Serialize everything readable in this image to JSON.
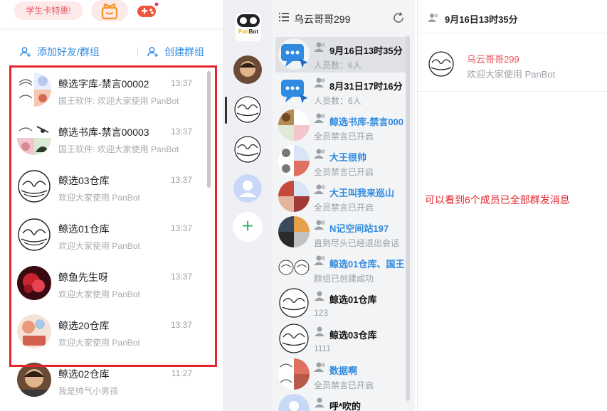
{
  "header": {
    "promo_label": "学生卡特惠!",
    "gift_icon": "gift-icon",
    "game_icon": "gamepad-icon"
  },
  "actions": {
    "add_friend_label": "添加好友/群组",
    "create_group_label": "创建群组"
  },
  "chats": [
    {
      "name": "鲸选字库-禁言00002",
      "time": "13:37",
      "message": "国王软件: 欢迎大家使用 PanBot"
    },
    {
      "name": "鲸选书库-禁言00003",
      "time": "13:37",
      "message": "国王软件: 欢迎大家使用 PanBot"
    },
    {
      "name": "鲸选03仓库",
      "time": "13:37",
      "message": "欢迎大家使用 PanBot"
    },
    {
      "name": "鲸选01仓库",
      "time": "13:37",
      "message": "欢迎大家使用 PanBot"
    },
    {
      "name": "鲸鱼先生呀",
      "time": "13:37",
      "message": "欢迎大家使用 PanBot"
    },
    {
      "name": "鲸选20仓库",
      "time": "13:37",
      "message": "欢迎大家使用 PanBot"
    },
    {
      "name": "鲸选02仓库",
      "time": "11:27",
      "message": "我是帅气小男孩"
    }
  ],
  "rail": {
    "logo_text_a": "Pan",
    "logo_text_b": "Bot",
    "add_label": "+"
  },
  "group_list": {
    "title": "乌云哥哥299",
    "items": [
      {
        "name": "9月16日13时35分",
        "sub": "人员数：6人"
      },
      {
        "name": "8月31日17时16分",
        "sub": "人员数：6人"
      },
      {
        "name": "鲸选书库-禁言000",
        "sub": "全员禁言已开启"
      },
      {
        "name": "大王很帅",
        "sub": "全员禁言已开启"
      },
      {
        "name": "大王叫我来巡山",
        "sub": "全员禁言已开启"
      },
      {
        "name": "N记空间站197",
        "sub": "直到尽头已经退出会话"
      },
      {
        "name": "鲸选01仓库、国王",
        "sub": "群组已创建成功"
      },
      {
        "name": "鲸选01仓库",
        "sub": "123"
      },
      {
        "name": "鲸选03仓库",
        "sub": "1111"
      },
      {
        "name": "数据啊",
        "sub": "全员禁言已开启"
      },
      {
        "name": "呼*吹的",
        "sub": ""
      }
    ]
  },
  "detail": {
    "title": "9月16日13时35分",
    "member_name": "乌云哥哥299",
    "member_welcome": "欢迎大家使用 PanBot"
  },
  "annotation": "可以看到6个成员已全部群发消息",
  "colors": {
    "accent": "#2f8ae0",
    "highlight_red": "#e2262b",
    "name_red": "#e8545d"
  }
}
